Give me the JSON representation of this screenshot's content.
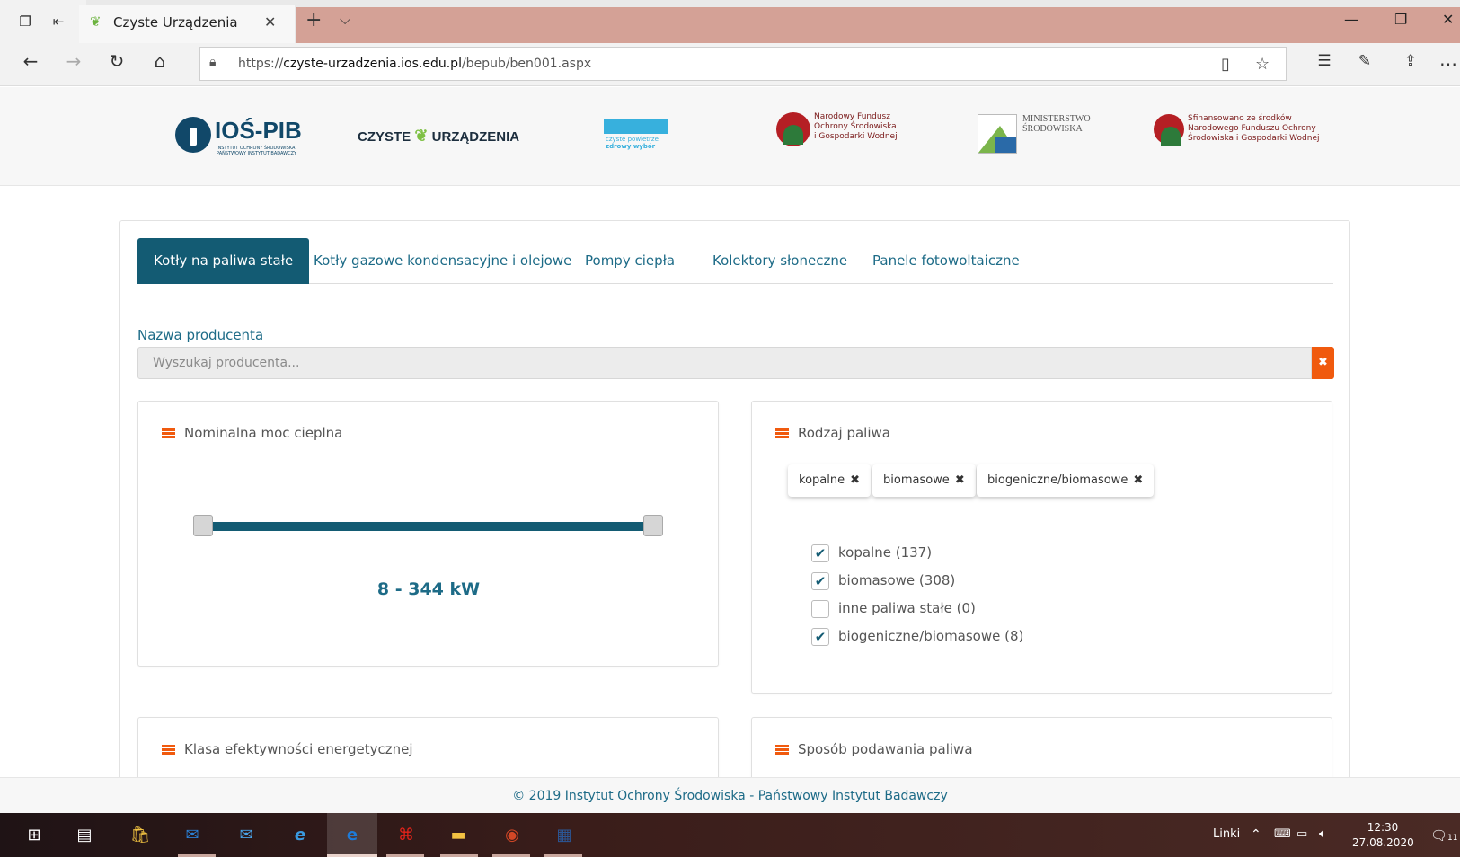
{
  "browser": {
    "tab_title": "Czyste Urządzenia",
    "tab_close": "✕",
    "new_tab": "+",
    "tab_menu": "⌵",
    "url_prefix": "https://",
    "url_host": "czyste-urzadzenia.ios.edu.pl",
    "url_path": "/bepub/ben001.aspx",
    "window_buttons": [
      "—",
      "❐",
      "✕"
    ]
  },
  "logos": {
    "ios_name": "IOŚ-PIB",
    "ios_sub": "INSTYTUT OCHRONY ŚRODOWISKA PAŃSTWOWY INSTYTUT BADAWCZY",
    "czyste_left": "CZYSTE",
    "czyste_right": "URZĄDZENIA",
    "cp_line1": "czyste powietrze",
    "cp_line2": "zdrowy wybór",
    "nfos_line1": "Narodowy Fundusz",
    "nfos_line2": "Ochrony Środowiska",
    "nfos_line3": "i Gospodarki Wodnej",
    "ms_line1": "MINISTERSTWO",
    "ms_line2": "ŚRODOWISKA",
    "sf_line1": "Sfinansowano ze środków",
    "sf_line2": "Narodowego Funduszu Ochrony",
    "sf_line3": "Środowiska i Gospodarki Wodnej"
  },
  "tabs": [
    {
      "label": "Kotły na paliwa stałe",
      "active": true
    },
    {
      "label": "Kotły gazowe kondensacyjne i olejowe",
      "active": false
    },
    {
      "label": "Pompy ciepła",
      "active": false
    },
    {
      "label": "Kolektory słoneczne",
      "active": false
    },
    {
      "label": "Panele fotowoltaiczne",
      "active": false
    }
  ],
  "producer": {
    "label": "Nazwa producenta",
    "placeholder": "Wyszukaj producenta...",
    "clear_icon": "✖"
  },
  "power_panel": {
    "title": "Nominalna moc cieplna",
    "min": 8,
    "max": 344,
    "value_text": "8 - 344 kW"
  },
  "fuel_panel": {
    "title": "Rodzaj paliwa",
    "chips": [
      {
        "label": "kopalne",
        "x": "✖"
      },
      {
        "label": "biomasowe",
        "x": "✖"
      },
      {
        "label": "biogeniczne/biomasowe",
        "x": "✖"
      }
    ],
    "options": [
      {
        "label": "kopalne (137)",
        "checked": true,
        "mark": "✔"
      },
      {
        "label": "biomasowe (308)",
        "checked": true,
        "mark": "✔"
      },
      {
        "label": "inne paliwa stałe (0)",
        "checked": false,
        "mark": ""
      },
      {
        "label": "biogeniczne/biomasowe (8)",
        "checked": true,
        "mark": "✔"
      }
    ]
  },
  "efficiency_panel": {
    "title": "Klasa efektywności energetycznej"
  },
  "feed_panel": {
    "title": "Sposób podawania paliwa"
  },
  "footer": {
    "text": "© 2019 Instytut Ochrony Środowiska - Państwowy Instytut Badawczy"
  },
  "taskbar": {
    "links_label": "Linki",
    "time": "12:30",
    "date": "27.08.2020",
    "notif_count": "11"
  },
  "colors": {
    "primary": "#135b73",
    "link": "#1d6b87",
    "accent": "#f05a0e"
  }
}
